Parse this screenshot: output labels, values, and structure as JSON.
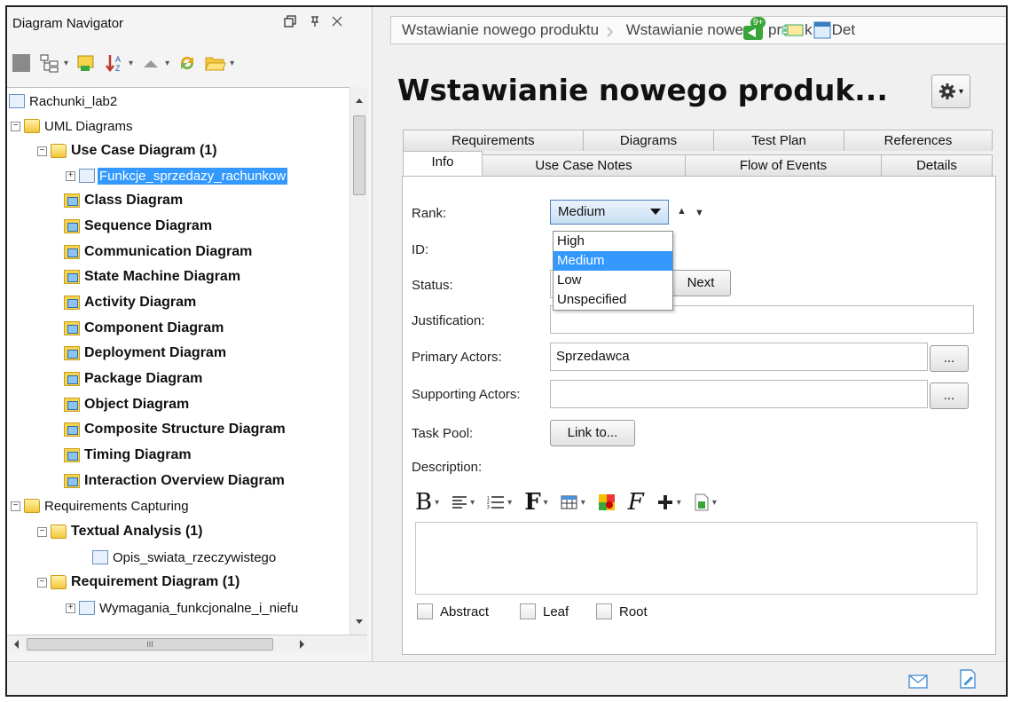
{
  "navigator": {
    "title": "Diagram Navigator",
    "tree": [
      {
        "label": "Rachunki_lab2",
        "bold": false
      },
      {
        "label": "UML Diagrams",
        "bold": false
      },
      {
        "label": "Use Case Diagram (1)",
        "bold": true
      },
      {
        "label": "Funkcje_sprzedazy_rachunkow",
        "bold": false,
        "selected": true
      },
      {
        "label": "Class Diagram",
        "bold": true
      },
      {
        "label": "Sequence Diagram",
        "bold": true
      },
      {
        "label": "Communication Diagram",
        "bold": true
      },
      {
        "label": "State Machine Diagram",
        "bold": true
      },
      {
        "label": "Activity Diagram",
        "bold": true
      },
      {
        "label": "Component Diagram",
        "bold": true
      },
      {
        "label": "Deployment Diagram",
        "bold": true
      },
      {
        "label": "Package Diagram",
        "bold": true
      },
      {
        "label": "Object Diagram",
        "bold": true
      },
      {
        "label": "Composite Structure Diagram",
        "bold": true
      },
      {
        "label": "Timing Diagram",
        "bold": true
      },
      {
        "label": "Interaction Overview Diagram",
        "bold": true
      },
      {
        "label": "Requirements Capturing",
        "bold": false
      },
      {
        "label": "Textual Analysis (1)",
        "bold": true
      },
      {
        "label": "Opis_swiata_rzeczywistego",
        "bold": false
      },
      {
        "label": "Requirement Diagram (1)",
        "bold": true
      },
      {
        "label": "Wymagania_funkcjonalne_i_niefu",
        "bold": false
      }
    ],
    "hscroll_grip": "III"
  },
  "breadcrumb": {
    "items": [
      "Wstawianie nowego produktu",
      "Wstawianie nowe",
      "pr",
      "k",
      "Det"
    ],
    "badge": "9+"
  },
  "editor": {
    "title": "Wstawianie nowego produk...",
    "tabs_back": [
      "Requirements",
      "Diagrams",
      "Test Plan",
      "References"
    ],
    "tabs_front": [
      "Info",
      "Use Case Notes",
      "Flow of Events",
      "Details"
    ],
    "active_tab": "Info",
    "fields": {
      "rank_label": "Rank:",
      "rank_value": "Medium",
      "rank_options": [
        "High",
        "Medium",
        "Low",
        "Unspecified"
      ],
      "id_label": "ID:",
      "status_label": "Status:",
      "next_button": "Next",
      "justification_label": "Justification:",
      "justification_value": "",
      "primary_actors_label": "Primary Actors:",
      "primary_actors_value": "Sprzedawca",
      "supporting_actors_label": "Supporting Actors:",
      "supporting_actors_value": "",
      "browse_button": "...",
      "task_pool_label": "Task Pool:",
      "link_button": "Link to...",
      "description_label": "Description:"
    },
    "checkboxes": [
      "Abstract",
      "Leaf",
      "Root"
    ]
  }
}
